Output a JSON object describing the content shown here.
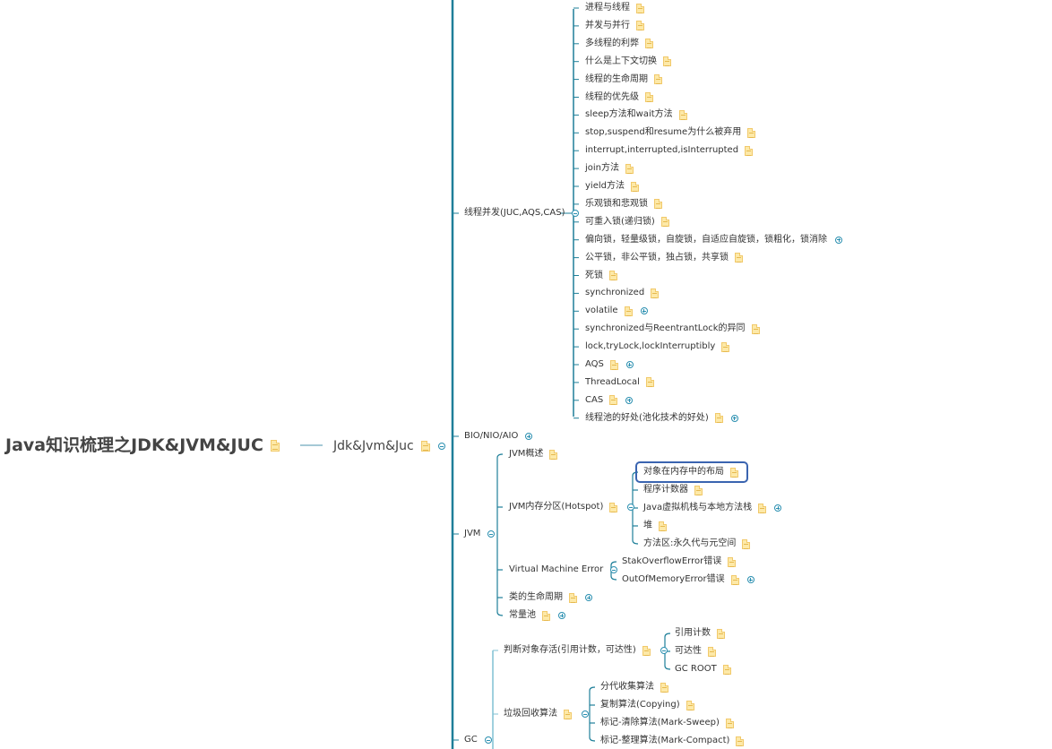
{
  "root": {
    "label": "Java知识梳理之JDK&JVM&JUC",
    "has_note": true
  },
  "main_topic": {
    "label": "Jdk&Jvm&Juc",
    "has_note": true,
    "expanded": true
  },
  "branches": [
    {
      "label": "线程并发(JUC,AQS,CAS)",
      "has_note": false,
      "expanded": true,
      "children": [
        {
          "label": "进程与线程",
          "has_note": true
        },
        {
          "label": "并发与并行",
          "has_note": true
        },
        {
          "label": "多线程的利弊",
          "has_note": true
        },
        {
          "label": "什么是上下文切换",
          "has_note": true
        },
        {
          "label": "线程的生命周期",
          "has_note": true
        },
        {
          "label": "线程的优先级",
          "has_note": true
        },
        {
          "label": "sleep方法和wait方法",
          "has_note": true
        },
        {
          "label": "stop,suspend和resume为什么被弃用",
          "has_note": true
        },
        {
          "label": "interrupt,interrupted,isInterrupted",
          "has_note": true
        },
        {
          "label": "join方法",
          "has_note": true
        },
        {
          "label": "yield方法",
          "has_note": true
        },
        {
          "label": "乐观锁和悲观锁",
          "has_note": true
        },
        {
          "label": "可重入锁(递归锁)",
          "has_note": true
        },
        {
          "label": "偏向锁，轻量级锁，自旋锁，自适应自旋锁，锁粗化，锁消除",
          "has_note": false,
          "collapsed": true
        },
        {
          "label": "公平锁，非公平锁，独占锁，共享锁",
          "has_note": true
        },
        {
          "label": "死锁",
          "has_note": true
        },
        {
          "label": "synchronized",
          "has_note": true
        },
        {
          "label": "volatile",
          "has_note": true,
          "collapsed": true
        },
        {
          "label": "synchronized与ReentrantLock的异同",
          "has_note": true
        },
        {
          "label": "lock,tryLock,lockInterruptibly",
          "has_note": true
        },
        {
          "label": "AQS",
          "has_note": true,
          "collapsed": true
        },
        {
          "label": "ThreadLocal",
          "has_note": true
        },
        {
          "label": "CAS",
          "has_note": true,
          "collapsed": true
        },
        {
          "label": "线程池的好处(池化技术的好处)",
          "has_note": true,
          "collapsed": true
        }
      ]
    },
    {
      "label": "BIO/NIO/AIO",
      "has_note": false,
      "collapsed": true
    },
    {
      "label": "JVM",
      "has_note": false,
      "expanded": true,
      "children": [
        {
          "label": "JVM概述",
          "has_note": true
        },
        {
          "label": "JVM内存分区(Hotspot)",
          "has_note": true,
          "expanded": true,
          "children": [
            {
              "label": "对象在内存中的布局",
              "has_note": true,
              "selected": true
            },
            {
              "label": "程序计数器",
              "has_note": true
            },
            {
              "label": "Java虚拟机栈与本地方法栈",
              "has_note": true,
              "collapsed": true
            },
            {
              "label": "堆",
              "has_note": true
            },
            {
              "label": "方法区:永久代与元空间",
              "has_note": true
            }
          ]
        },
        {
          "label": "Virtual Machine Error",
          "has_note": false,
          "expanded": true,
          "children": [
            {
              "label": "StakOverflowError错误",
              "has_note": true
            },
            {
              "label": "OutOfMemoryError错误",
              "has_note": true,
              "collapsed": true
            }
          ]
        },
        {
          "label": "类的生命周期",
          "has_note": true,
          "collapsed": true
        },
        {
          "label": "常量池",
          "has_note": true,
          "collapsed": true
        }
      ]
    },
    {
      "label": "GC",
      "has_note": false,
      "expanded": true,
      "children": [
        {
          "label": "判断对象存活(引用计数，可达性)",
          "has_note": true,
          "expanded": true,
          "children": [
            {
              "label": "引用计数",
              "has_note": true
            },
            {
              "label": "可达性",
              "has_note": true
            },
            {
              "label": "GC ROOT",
              "has_note": true
            }
          ]
        },
        {
          "label": "垃圾回收算法",
          "has_note": true,
          "expanded": true,
          "children": [
            {
              "label": "分代收集算法",
              "has_note": true
            },
            {
              "label": "复制算法(Copying)",
              "has_note": true
            },
            {
              "label": "标记-清除算法(Mark-Sweep)",
              "has_note": true
            },
            {
              "label": "标记-整理算法(Mark-Compact)",
              "has_note": true
            }
          ]
        }
      ]
    }
  ],
  "colors": {
    "branch_line": "#1e7f99",
    "sub_line": "#7fc0d3",
    "selection": "#3a64b0",
    "note_fill": "#fde9a8"
  }
}
